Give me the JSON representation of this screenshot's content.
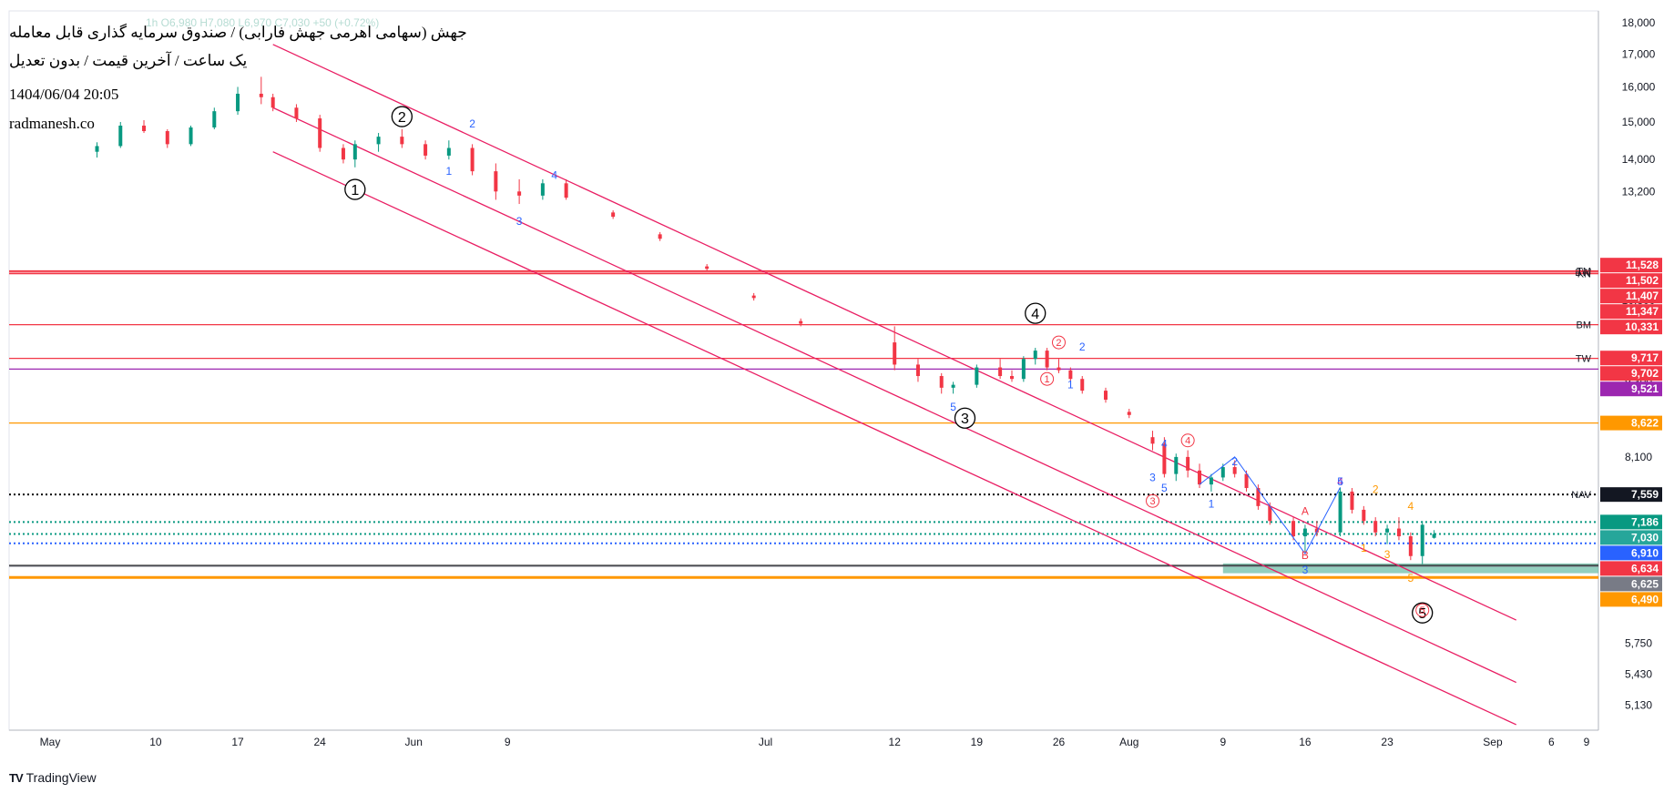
{
  "header": {
    "line1": "جهش (سهامی اهرمی جهش فارابی) / صندوق سرمایه گذاری قابل معامله",
    "line2": "یک ساعت / آخرین قیمت / بدون تعدیل",
    "datetime": "1404/06/04 20:05",
    "site": "radmanesh.co",
    "ticker_line": "1h  O6,980  H7,080  L6,970  C7,030  +50 (+0.72%)"
  },
  "brand": {
    "logo": "TV",
    "name": "TradingView"
  },
  "chart_data": {
    "type": "candlestick",
    "interval": "1h",
    "y_axis": {
      "scale": "log",
      "ylim": [
        4900,
        18400
      ],
      "tick_labels": [
        "18,000",
        "17,000",
        "16,000",
        "15,000",
        "14,000",
        "13,200",
        "10,800",
        "9,300",
        "8,100",
        "5,750",
        "5,430",
        "5,130"
      ],
      "tick_values": [
        18000,
        17000,
        16000,
        15000,
        14000,
        13200,
        10800,
        9300,
        8100,
        5750,
        5430,
        5130
      ]
    },
    "x_axis": {
      "tick_labels": [
        "May",
        "10",
        "17",
        "24",
        "Jun",
        "9",
        "Jul",
        "12",
        "19",
        "26",
        "Aug",
        "9",
        "16",
        "23",
        "Sep",
        "6",
        "9"
      ],
      "tick_dates": [
        "2025-05-01",
        "2025-05-10",
        "2025-05-17",
        "2025-05-24",
        "2025-06-01",
        "2025-06-09",
        "2025-07-01",
        "2025-07-12",
        "2025-07-19",
        "2025-07-26",
        "2025-08-01",
        "2025-08-09",
        "2025-08-16",
        "2025-08-23",
        "2025-09-01",
        "2025-09-06",
        "2025-09-09"
      ]
    },
    "grid": false,
    "candles": [
      {
        "d": "2025-05-05",
        "o": 14200,
        "h": 14450,
        "l": 14050,
        "c": 14350
      },
      {
        "d": "2025-05-07",
        "o": 14350,
        "h": 15000,
        "l": 14300,
        "c": 14900
      },
      {
        "d": "2025-05-09",
        "o": 14900,
        "h": 15050,
        "l": 14700,
        "c": 14750
      },
      {
        "d": "2025-05-11",
        "o": 14750,
        "h": 14800,
        "l": 14300,
        "c": 14400
      },
      {
        "d": "2025-05-13",
        "o": 14400,
        "h": 14900,
        "l": 14350,
        "c": 14850
      },
      {
        "d": "2025-05-15",
        "o": 14850,
        "h": 15400,
        "l": 14800,
        "c": 15300
      },
      {
        "d": "2025-05-17",
        "o": 15300,
        "h": 16000,
        "l": 15200,
        "c": 15800
      },
      {
        "d": "2025-05-19",
        "o": 15800,
        "h": 16300,
        "l": 15500,
        "c": 15700
      },
      {
        "d": "2025-05-20",
        "o": 15700,
        "h": 15800,
        "l": 15300,
        "c": 15400
      },
      {
        "d": "2025-05-22",
        "o": 15400,
        "h": 15500,
        "l": 15000,
        "c": 15100
      },
      {
        "d": "2025-05-24",
        "o": 15100,
        "h": 15200,
        "l": 14200,
        "c": 14300
      },
      {
        "d": "2025-05-26",
        "o": 14300,
        "h": 14400,
        "l": 13900,
        "c": 14000
      },
      {
        "d": "2025-05-27",
        "o": 14000,
        "h": 14500,
        "l": 13800,
        "c": 14400
      },
      {
        "d": "2025-05-29",
        "o": 14400,
        "h": 14700,
        "l": 14200,
        "c": 14600
      },
      {
        "d": "2025-05-31",
        "o": 14600,
        "h": 14800,
        "l": 14300,
        "c": 14400
      },
      {
        "d": "2025-06-02",
        "o": 14400,
        "h": 14500,
        "l": 14000,
        "c": 14100
      },
      {
        "d": "2025-06-04",
        "o": 14100,
        "h": 14500,
        "l": 14000,
        "c": 14300
      },
      {
        "d": "2025-06-06",
        "o": 14300,
        "h": 14400,
        "l": 13600,
        "c": 13700
      },
      {
        "d": "2025-06-08",
        "o": 13700,
        "h": 13900,
        "l": 13000,
        "c": 13200
      },
      {
        "d": "2025-06-10",
        "o": 13200,
        "h": 13500,
        "l": 12900,
        "c": 13100
      },
      {
        "d": "2025-06-12",
        "o": 13100,
        "h": 13500,
        "l": 13000,
        "c": 13400
      },
      {
        "d": "2025-06-14",
        "o": 13400,
        "h": 13500,
        "l": 13000,
        "c": 13050
      },
      {
        "d": "2025-06-18",
        "o": 12700,
        "h": 12750,
        "l": 12550,
        "c": 12600
      },
      {
        "d": "2025-06-22",
        "o": 12200,
        "h": 12250,
        "l": 12050,
        "c": 12100
      },
      {
        "d": "2025-06-26",
        "o": 11500,
        "h": 11550,
        "l": 11400,
        "c": 11450
      },
      {
        "d": "2025-06-30",
        "o": 10900,
        "h": 10950,
        "l": 10800,
        "c": 10850
      },
      {
        "d": "2025-07-04",
        "o": 10400,
        "h": 10450,
        "l": 10300,
        "c": 10350
      },
      {
        "d": "2025-07-12",
        "o": 10000,
        "h": 10300,
        "l": 9500,
        "c": 9600
      },
      {
        "d": "2025-07-14",
        "o": 9600,
        "h": 9700,
        "l": 9300,
        "c": 9400
      },
      {
        "d": "2025-07-16",
        "o": 9400,
        "h": 9450,
        "l": 9100,
        "c": 9200
      },
      {
        "d": "2025-07-17",
        "o": 9200,
        "h": 9300,
        "l": 9100,
        "c": 9250
      },
      {
        "d": "2025-07-19",
        "o": 9250,
        "h": 9600,
        "l": 9200,
        "c": 9550
      },
      {
        "d": "2025-07-21",
        "o": 9550,
        "h": 9700,
        "l": 9350,
        "c": 9400
      },
      {
        "d": "2025-07-22",
        "o": 9400,
        "h": 9500,
        "l": 9300,
        "c": 9350
      },
      {
        "d": "2025-07-23",
        "o": 9350,
        "h": 9750,
        "l": 9300,
        "c": 9700
      },
      {
        "d": "2025-07-24",
        "o": 9700,
        "h": 9900,
        "l": 9600,
        "c": 9850
      },
      {
        "d": "2025-07-25",
        "o": 9850,
        "h": 9900,
        "l": 9500,
        "c": 9550
      },
      {
        "d": "2025-07-26",
        "o": 9550,
        "h": 9700,
        "l": 9450,
        "c": 9500
      },
      {
        "d": "2025-07-27",
        "o": 9500,
        "h": 9550,
        "l": 9300,
        "c": 9350
      },
      {
        "d": "2025-07-28",
        "o": 9350,
        "h": 9400,
        "l": 9100,
        "c": 9150
      },
      {
        "d": "2025-07-30",
        "o": 9150,
        "h": 9200,
        "l": 8950,
        "c": 9000
      },
      {
        "d": "2025-08-01",
        "o": 8800,
        "h": 8850,
        "l": 8700,
        "c": 8750
      },
      {
        "d": "2025-08-03",
        "o": 8400,
        "h": 8500,
        "l": 8200,
        "c": 8300
      },
      {
        "d": "2025-08-04",
        "o": 8300,
        "h": 8400,
        "l": 7800,
        "c": 7850
      },
      {
        "d": "2025-08-05",
        "o": 7850,
        "h": 8150,
        "l": 7750,
        "c": 8100
      },
      {
        "d": "2025-08-06",
        "o": 8100,
        "h": 8200,
        "l": 7800,
        "c": 7900
      },
      {
        "d": "2025-08-07",
        "o": 7900,
        "h": 8000,
        "l": 7650,
        "c": 7700
      },
      {
        "d": "2025-08-08",
        "o": 7700,
        "h": 7850,
        "l": 7600,
        "c": 7800
      },
      {
        "d": "2025-08-09",
        "o": 7800,
        "h": 8000,
        "l": 7750,
        "c": 7950
      },
      {
        "d": "2025-08-10",
        "o": 7950,
        "h": 8050,
        "l": 7800,
        "c": 7850
      },
      {
        "d": "2025-08-11",
        "o": 7850,
        "h": 7900,
        "l": 7600,
        "c": 7650
      },
      {
        "d": "2025-08-12",
        "o": 7650,
        "h": 7700,
        "l": 7350,
        "c": 7400
      },
      {
        "d": "2025-08-13",
        "o": 7400,
        "h": 7450,
        "l": 7150,
        "c": 7200
      },
      {
        "d": "2025-08-15",
        "o": 7200,
        "h": 7250,
        "l": 6950,
        "c": 7000
      },
      {
        "d": "2025-08-16",
        "o": 7000,
        "h": 7150,
        "l": 6800,
        "c": 7100
      },
      {
        "d": "2025-08-17",
        "o": 7100,
        "h": 7200,
        "l": 7000,
        "c": 7050
      },
      {
        "d": "2025-08-19",
        "o": 7050,
        "h": 7650,
        "l": 7000,
        "c": 7600
      },
      {
        "d": "2025-08-20",
        "o": 7600,
        "h": 7650,
        "l": 7300,
        "c": 7350
      },
      {
        "d": "2025-08-21",
        "o": 7350,
        "h": 7400,
        "l": 7150,
        "c": 7200
      },
      {
        "d": "2025-08-22",
        "o": 7200,
        "h": 7250,
        "l": 7000,
        "c": 7050
      },
      {
        "d": "2025-08-23",
        "o": 7050,
        "h": 7150,
        "l": 6900,
        "c": 7100
      },
      {
        "d": "2025-08-24",
        "o": 7100,
        "h": 7250,
        "l": 6950,
        "c": 7000
      },
      {
        "d": "2025-08-25",
        "o": 7000,
        "h": 7050,
        "l": 6700,
        "c": 6750
      },
      {
        "d": "2025-08-26",
        "o": 6750,
        "h": 7200,
        "l": 6650,
        "c": 7150
      },
      {
        "d": "2025-08-27",
        "o": 6980,
        "h": 7080,
        "l": 6970,
        "c": 7030
      }
    ],
    "channel_lines": [
      {
        "p1": [
          "2025-05-20",
          17300
        ],
        "p2": [
          "2025-09-03",
          6000
        ]
      },
      {
        "p1": [
          "2025-05-20",
          15400
        ],
        "p2": [
          "2025-09-03",
          5350
        ]
      },
      {
        "p1": [
          "2025-05-20",
          14200
        ],
        "p2": [
          "2025-09-03",
          4950
        ]
      }
    ],
    "levels": [
      {
        "price": 11347,
        "color": "#f23645",
        "label": "KN",
        "style": "solid"
      },
      {
        "price": 11380,
        "color": "#f23645",
        "label": "BW",
        "style": "solid"
      },
      {
        "price": 11407,
        "color": "#f23645",
        "label": "TM",
        "style": "solid"
      },
      {
        "price": 10331,
        "color": "#f23645",
        "label": "BM",
        "style": "solid"
      },
      {
        "price": 9710,
        "color": "#f23645",
        "label": "TW",
        "style": "solid"
      },
      {
        "price": 9521,
        "color": "#9c27b0",
        "label": "",
        "style": "solid"
      },
      {
        "price": 8622,
        "color": "#ff9800",
        "label": "",
        "style": "solid"
      },
      {
        "price": 7559,
        "color": "#000000",
        "label": "NAV",
        "style": "dotted"
      },
      {
        "price": 7186,
        "color": "#089981",
        "label": "",
        "style": "dotted"
      },
      {
        "price": 7030,
        "color": "#089981",
        "label": "",
        "style": "dotted"
      },
      {
        "price": 6910,
        "color": "#2962ff",
        "label": "",
        "style": "dotted"
      },
      {
        "price": 6634,
        "color": "#000000",
        "label": "",
        "style": "solid"
      },
      {
        "price": 6625,
        "color": "#787b86",
        "label": "",
        "style": "solid"
      },
      {
        "price": 6490,
        "color": "#ff9800",
        "label": "",
        "style": "thick"
      }
    ],
    "zone": {
      "from_date": "2025-08-09",
      "to_date": "2025-09-09",
      "low": 6540,
      "high": 6660,
      "color": "#6fbfa8"
    },
    "price_labels": [
      {
        "price": 11528,
        "text": "11,528",
        "bg": "#f23645"
      },
      {
        "price": 11502,
        "text": "11,502",
        "bg": "#f23645"
      },
      {
        "price": 11407,
        "text": "11,407",
        "bg": "#f23645"
      },
      {
        "price": 11347,
        "text": "11,347",
        "bg": "#f23645"
      },
      {
        "price": 10331,
        "text": "10,331",
        "bg": "#f23645"
      },
      {
        "price": 9717,
        "text": "9,717",
        "bg": "#f23645"
      },
      {
        "price": 9702,
        "text": "9,702",
        "bg": "#f23645"
      },
      {
        "price": 9521,
        "text": "9,521",
        "bg": "#9c27b0"
      },
      {
        "price": 8622,
        "text": "8,622",
        "bg": "#ff9800"
      },
      {
        "price": 7559,
        "text": "7,559",
        "bg": "#131722"
      },
      {
        "price": 7186,
        "text": "7,186",
        "bg": "#089981"
      },
      {
        "price": 7030,
        "text": "7,030",
        "bg": "#26a69a"
      },
      {
        "price": 6910,
        "text": "6,910",
        "bg": "#2962ff"
      },
      {
        "price": 6634,
        "text": "6,634",
        "bg": "#f23645"
      },
      {
        "price": 6625,
        "text": "6,625",
        "bg": "#787b86"
      },
      {
        "price": 6490,
        "text": "6,490",
        "bg": "#ff9800"
      }
    ],
    "wave_labels": [
      {
        "text": "1",
        "d": "2025-05-27",
        "p": 13250,
        "style": "circle",
        "color": "#000000"
      },
      {
        "text": "2",
        "d": "2025-05-31",
        "p": 15150,
        "style": "circle",
        "color": "#000000"
      },
      {
        "text": "3",
        "d": "2025-07-18",
        "p": 8700,
        "style": "circle",
        "color": "#000000"
      },
      {
        "text": "4",
        "d": "2025-07-24",
        "p": 10550,
        "style": "circle",
        "color": "#000000"
      },
      {
        "text": "5",
        "d": "2025-08-26",
        "p": 6080,
        "style": "circle",
        "color": "#000000"
      },
      {
        "text": "1",
        "d": "2025-07-25",
        "p": 9350,
        "style": "ring",
        "color": "#f23645"
      },
      {
        "text": "2",
        "d": "2025-07-26",
        "p": 10000,
        "style": "ring",
        "color": "#f23645"
      },
      {
        "text": "3",
        "d": "2025-08-03",
        "p": 7470,
        "style": "ring",
        "color": "#f23645"
      },
      {
        "text": "4",
        "d": "2025-08-06",
        "p": 8350,
        "style": "ring",
        "color": "#f23645"
      },
      {
        "text": "5",
        "d": "2025-08-26",
        "p": 6110,
        "style": "ring",
        "color": "#f23645"
      },
      {
        "text": "1",
        "d": "2025-06-04",
        "p": 13700,
        "style": "plain",
        "color": "#2962ff"
      },
      {
        "text": "2",
        "d": "2025-06-06",
        "p": 14950,
        "style": "plain",
        "color": "#2962ff"
      },
      {
        "text": "3",
        "d": "2025-06-10",
        "p": 12500,
        "style": "plain",
        "color": "#2962ff"
      },
      {
        "text": "4",
        "d": "2025-06-13",
        "p": 13600,
        "style": "plain",
        "color": "#2962ff"
      },
      {
        "text": "5",
        "d": "2025-07-17",
        "p": 8880,
        "style": "plain",
        "color": "#2962ff"
      },
      {
        "text": "1",
        "d": "2025-07-27",
        "p": 9250,
        "style": "plain",
        "color": "#2962ff"
      },
      {
        "text": "2",
        "d": "2025-07-28",
        "p": 9920,
        "style": "plain",
        "color": "#2962ff"
      },
      {
        "text": "3",
        "d": "2025-08-03",
        "p": 7800,
        "style": "plain",
        "color": "#2962ff"
      },
      {
        "text": "4",
        "d": "2025-08-04",
        "p": 8300,
        "style": "plain",
        "color": "#2962ff"
      },
      {
        "text": "5",
        "d": "2025-08-04",
        "p": 7650,
        "style": "plain",
        "color": "#2962ff"
      },
      {
        "text": "1",
        "d": "2025-08-08",
        "p": 7430,
        "style": "plain",
        "color": "#2962ff"
      },
      {
        "text": "2",
        "d": "2025-08-10",
        "p": 8030,
        "style": "plain",
        "color": "#2962ff"
      },
      {
        "text": "3",
        "d": "2025-08-16",
        "p": 6580,
        "style": "plain",
        "color": "#2962ff"
      },
      {
        "text": "4",
        "d": "2025-08-19",
        "p": 7740,
        "style": "plain",
        "color": "#9c27b0"
      },
      {
        "text": "5",
        "d": "2025-08-19",
        "p": 7740,
        "style": "plain",
        "color": "#2962ff"
      },
      {
        "text": "A",
        "d": "2025-08-16",
        "p": 7330,
        "style": "plain",
        "color": "#f23645"
      },
      {
        "text": "B",
        "d": "2025-08-16",
        "p": 6760,
        "style": "plain",
        "color": "#f23645"
      },
      {
        "text": "1",
        "d": "2025-08-21",
        "p": 6850,
        "style": "plain",
        "color": "#ff9800"
      },
      {
        "text": "2",
        "d": "2025-08-22",
        "p": 7630,
        "style": "plain",
        "color": "#ff9800"
      },
      {
        "text": "3",
        "d": "2025-08-23",
        "p": 6770,
        "style": "plain",
        "color": "#ff9800"
      },
      {
        "text": "4",
        "d": "2025-08-25",
        "p": 7400,
        "style": "plain",
        "color": "#ff9800"
      },
      {
        "text": "5",
        "d": "2025-08-25",
        "p": 6480,
        "style": "plain",
        "color": "#ff9800"
      }
    ],
    "wave_paths": [
      {
        "color": "#2962ff",
        "points": [
          [
            "2025-08-07",
            7700
          ],
          [
            "2025-08-10",
            8100
          ],
          [
            "2025-08-13",
            7400
          ],
          [
            "2025-08-16",
            6780
          ],
          [
            "2025-08-19",
            7660
          ]
        ]
      }
    ]
  }
}
